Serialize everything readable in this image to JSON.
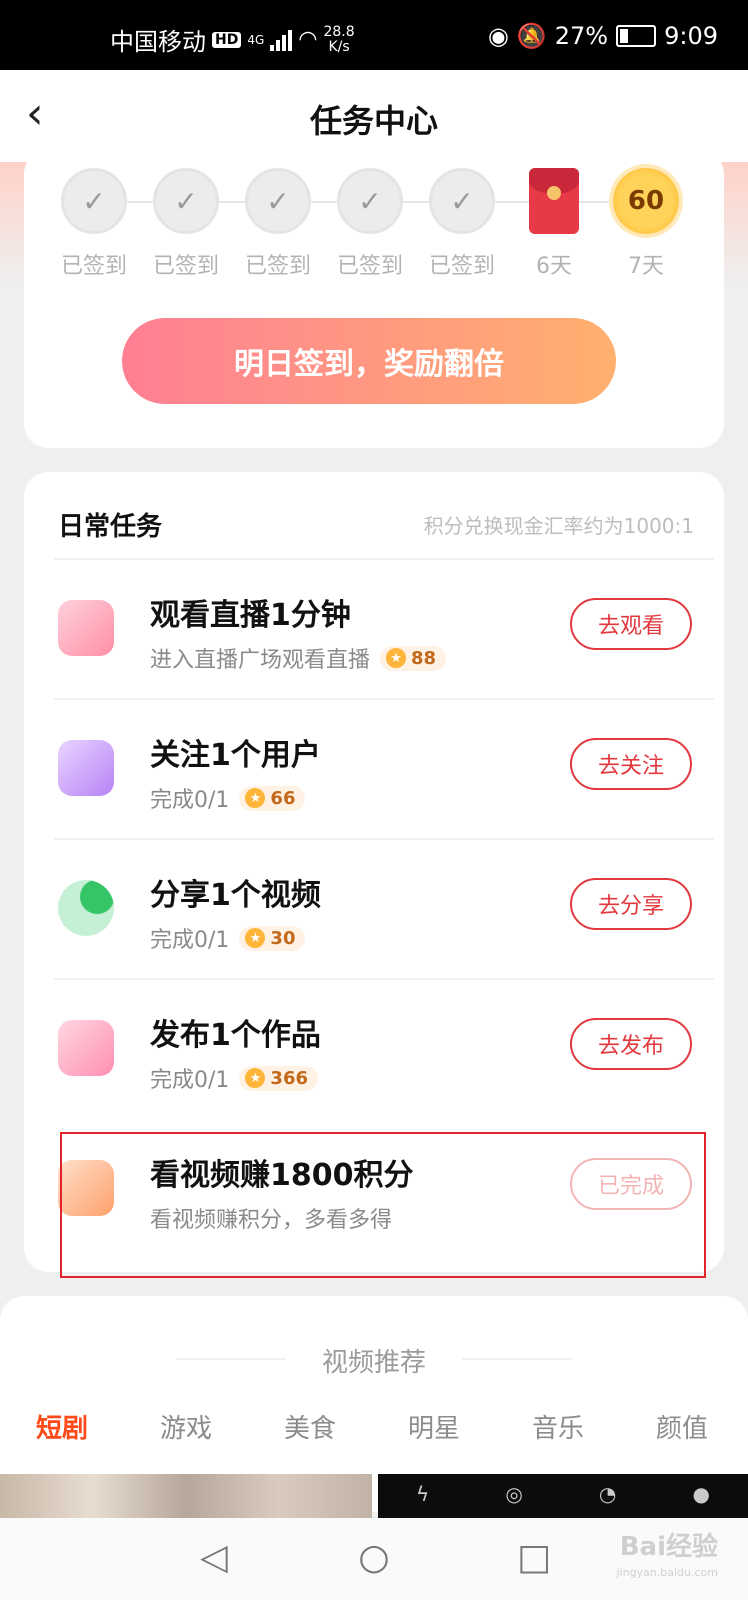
{
  "status_bar": {
    "carrier": "中国移动",
    "hd": "HD",
    "network": "4G",
    "speed_value": "28.8",
    "speed_unit": "K/s",
    "battery": "27%",
    "time": "9:09"
  },
  "header": {
    "title": "任务中心"
  },
  "checkin": {
    "days": [
      {
        "label": "已签到",
        "state": "checked"
      },
      {
        "label": "已签到",
        "state": "checked"
      },
      {
        "label": "已签到",
        "state": "checked"
      },
      {
        "label": "已签到",
        "state": "checked"
      },
      {
        "label": "已签到",
        "state": "checked"
      },
      {
        "label": "6天",
        "state": "red-packet"
      },
      {
        "label": "7天",
        "state": "coin",
        "coin_value": "60"
      }
    ],
    "button_label": "明日签到，奖励翻倍"
  },
  "daily": {
    "title": "日常任务",
    "note": "积分兑换现金汇率约为1000:1",
    "tasks": [
      {
        "name": "观看直播1分钟",
        "sub": "进入直播广场观看直播",
        "points": "88",
        "button": "去观看",
        "icon": "live-icon",
        "color": "#ff8fa5"
      },
      {
        "name": "关注1个用户",
        "sub": "完成0/1",
        "points": "66",
        "button": "去关注",
        "icon": "users-icon",
        "color": "#b783f5"
      },
      {
        "name": "分享1个视频",
        "sub": "完成0/1",
        "points": "30",
        "button": "去分享",
        "icon": "share-icon",
        "color": "#4cd07a"
      },
      {
        "name": "发布1个作品",
        "sub": "完成0/1",
        "points": "366",
        "button": "去发布",
        "icon": "camera-icon",
        "color": "#ff8fb0"
      },
      {
        "name": "看视频赚1800积分",
        "sub": "看视频赚积分，多看多得",
        "button": "已完成",
        "icon": "video-icon",
        "color": "#ffa06a",
        "done": true
      }
    ]
  },
  "recommend": {
    "title": "视频推荐",
    "categories": [
      "短剧",
      "游戏",
      "美食",
      "明星",
      "音乐",
      "颜值"
    ],
    "active_index": 0
  },
  "watermark": {
    "brand": "Bai经验",
    "sub": "jingyan.baidu.com"
  }
}
